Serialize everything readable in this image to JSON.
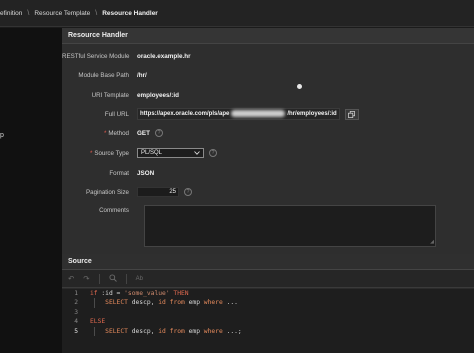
{
  "breadcrumb": {
    "items": [
      "efinition",
      "Resource Template",
      "Resource Handler"
    ],
    "separator": "\\"
  },
  "left": {
    "mark": "p"
  },
  "resource_handler": {
    "title": "Resource Handler",
    "fields": {
      "restful_service_module": {
        "label": "RESTful Service Module",
        "value": "oracle.example.hr"
      },
      "module_base_path": {
        "label": "Module Base Path",
        "value": "/hr/"
      },
      "uri_template": {
        "label": "URI Template",
        "value": "employees/:id"
      },
      "full_url": {
        "label": "Full URL",
        "value_prefix": "https://apex.oracle.com/pls/ape",
        "value_suffix": "/hr/employees/:id"
      },
      "method": {
        "label": "Method",
        "value": "GET"
      },
      "source_type": {
        "label": "Source Type",
        "value": "PL/SQL"
      },
      "format": {
        "label": "Format",
        "value": "JSON"
      },
      "pagination_size": {
        "label": "Pagination Size",
        "value": "25"
      },
      "comments": {
        "label": "Comments",
        "value": ""
      }
    },
    "required_marker": "*",
    "help_glyph": "?"
  },
  "source": {
    "title": "Source",
    "toolbar_icons": [
      "undo-icon",
      "redo-icon",
      "search-icon",
      "replace-icon"
    ],
    "code_lines": [
      {
        "n": "1",
        "tokens": [
          [
            "kw",
            "if "
          ],
          [
            "plain",
            ":id = "
          ],
          [
            "str",
            "'some_value'"
          ],
          [
            "kw",
            " THEN"
          ]
        ]
      },
      {
        "n": "2",
        "tokens": [
          [
            "plain",
            "    "
          ],
          [
            "kw2",
            "SELECT"
          ],
          [
            "plain",
            " descp, "
          ],
          [
            "kw2",
            "id"
          ],
          [
            "plain",
            " "
          ],
          [
            "kw2",
            "from"
          ],
          [
            "plain",
            " emp "
          ],
          [
            "kw2",
            "where"
          ],
          [
            "plain",
            " ..."
          ]
        ]
      },
      {
        "n": "3",
        "tokens": []
      },
      {
        "n": "4",
        "tokens": [
          [
            "kw",
            "ELSE"
          ]
        ]
      },
      {
        "n": "5",
        "tokens": [
          [
            "plain",
            "    "
          ],
          [
            "kw2",
            "SELECT"
          ],
          [
            "plain",
            " descp, "
          ],
          [
            "kw2",
            "id"
          ],
          [
            "plain",
            " "
          ],
          [
            "kw2",
            "from"
          ],
          [
            "plain",
            " emp "
          ],
          [
            "kw2",
            "where"
          ],
          [
            "plain",
            " ...;"
          ]
        ]
      }
    ],
    "active_line": "5"
  },
  "colors": {
    "accent_required": "#e05a4e",
    "keyword": "#e0694f",
    "string": "#d08b6e"
  }
}
